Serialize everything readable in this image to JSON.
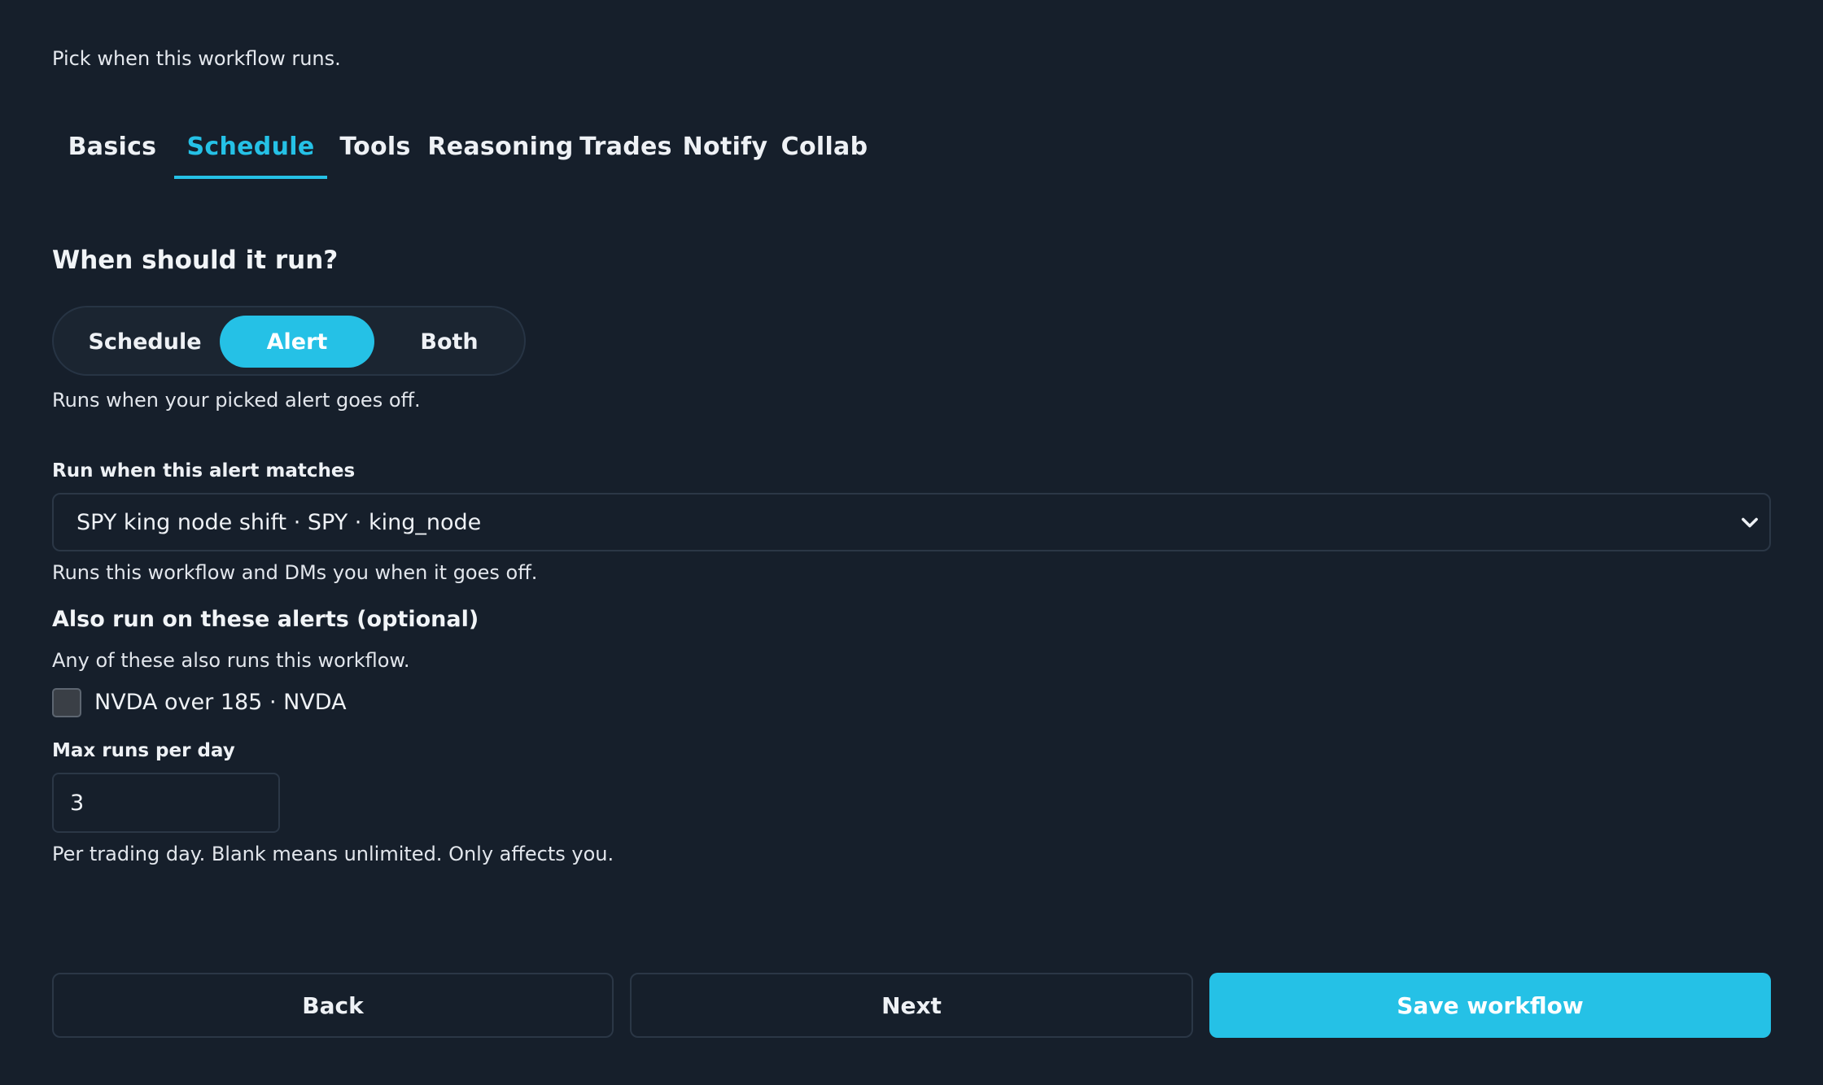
{
  "intro": "Pick when this workflow runs.",
  "tabs": [
    {
      "label": "Basics"
    },
    {
      "label": "Schedule"
    },
    {
      "label": "Tools"
    },
    {
      "label": "Reasoning"
    },
    {
      "label": "Trades"
    },
    {
      "label": "Notify"
    },
    {
      "label": "Collab"
    }
  ],
  "active_tab": "Schedule",
  "trigger": {
    "heading": "When should it run?",
    "options": [
      "Schedule",
      "Alert",
      "Both"
    ],
    "selected": "Alert",
    "help": "Runs when your picked alert goes off."
  },
  "alert_select": {
    "label": "Run when this alert matches",
    "value": "SPY king node shift · SPY · king_node",
    "help": "Runs this workflow and DMs you when it goes off."
  },
  "extra_alerts": {
    "heading": "Also run on these alerts (optional)",
    "help": "Any of these also runs this workflow.",
    "items": [
      {
        "label": "NVDA over 185 · NVDA",
        "checked": false
      }
    ]
  },
  "max_runs": {
    "label": "Max runs per day",
    "value": "3",
    "help": "Per trading day. Blank means unlimited. Only affects you."
  },
  "footer": {
    "back_label": "Back",
    "next_label": "Next",
    "save_label": "Save workflow"
  },
  "colors": {
    "background": "#161f2b",
    "accent": "#25c1e6",
    "border": "#2b3746"
  },
  "icons": {
    "select_chevron": "chevron-down-icon"
  }
}
